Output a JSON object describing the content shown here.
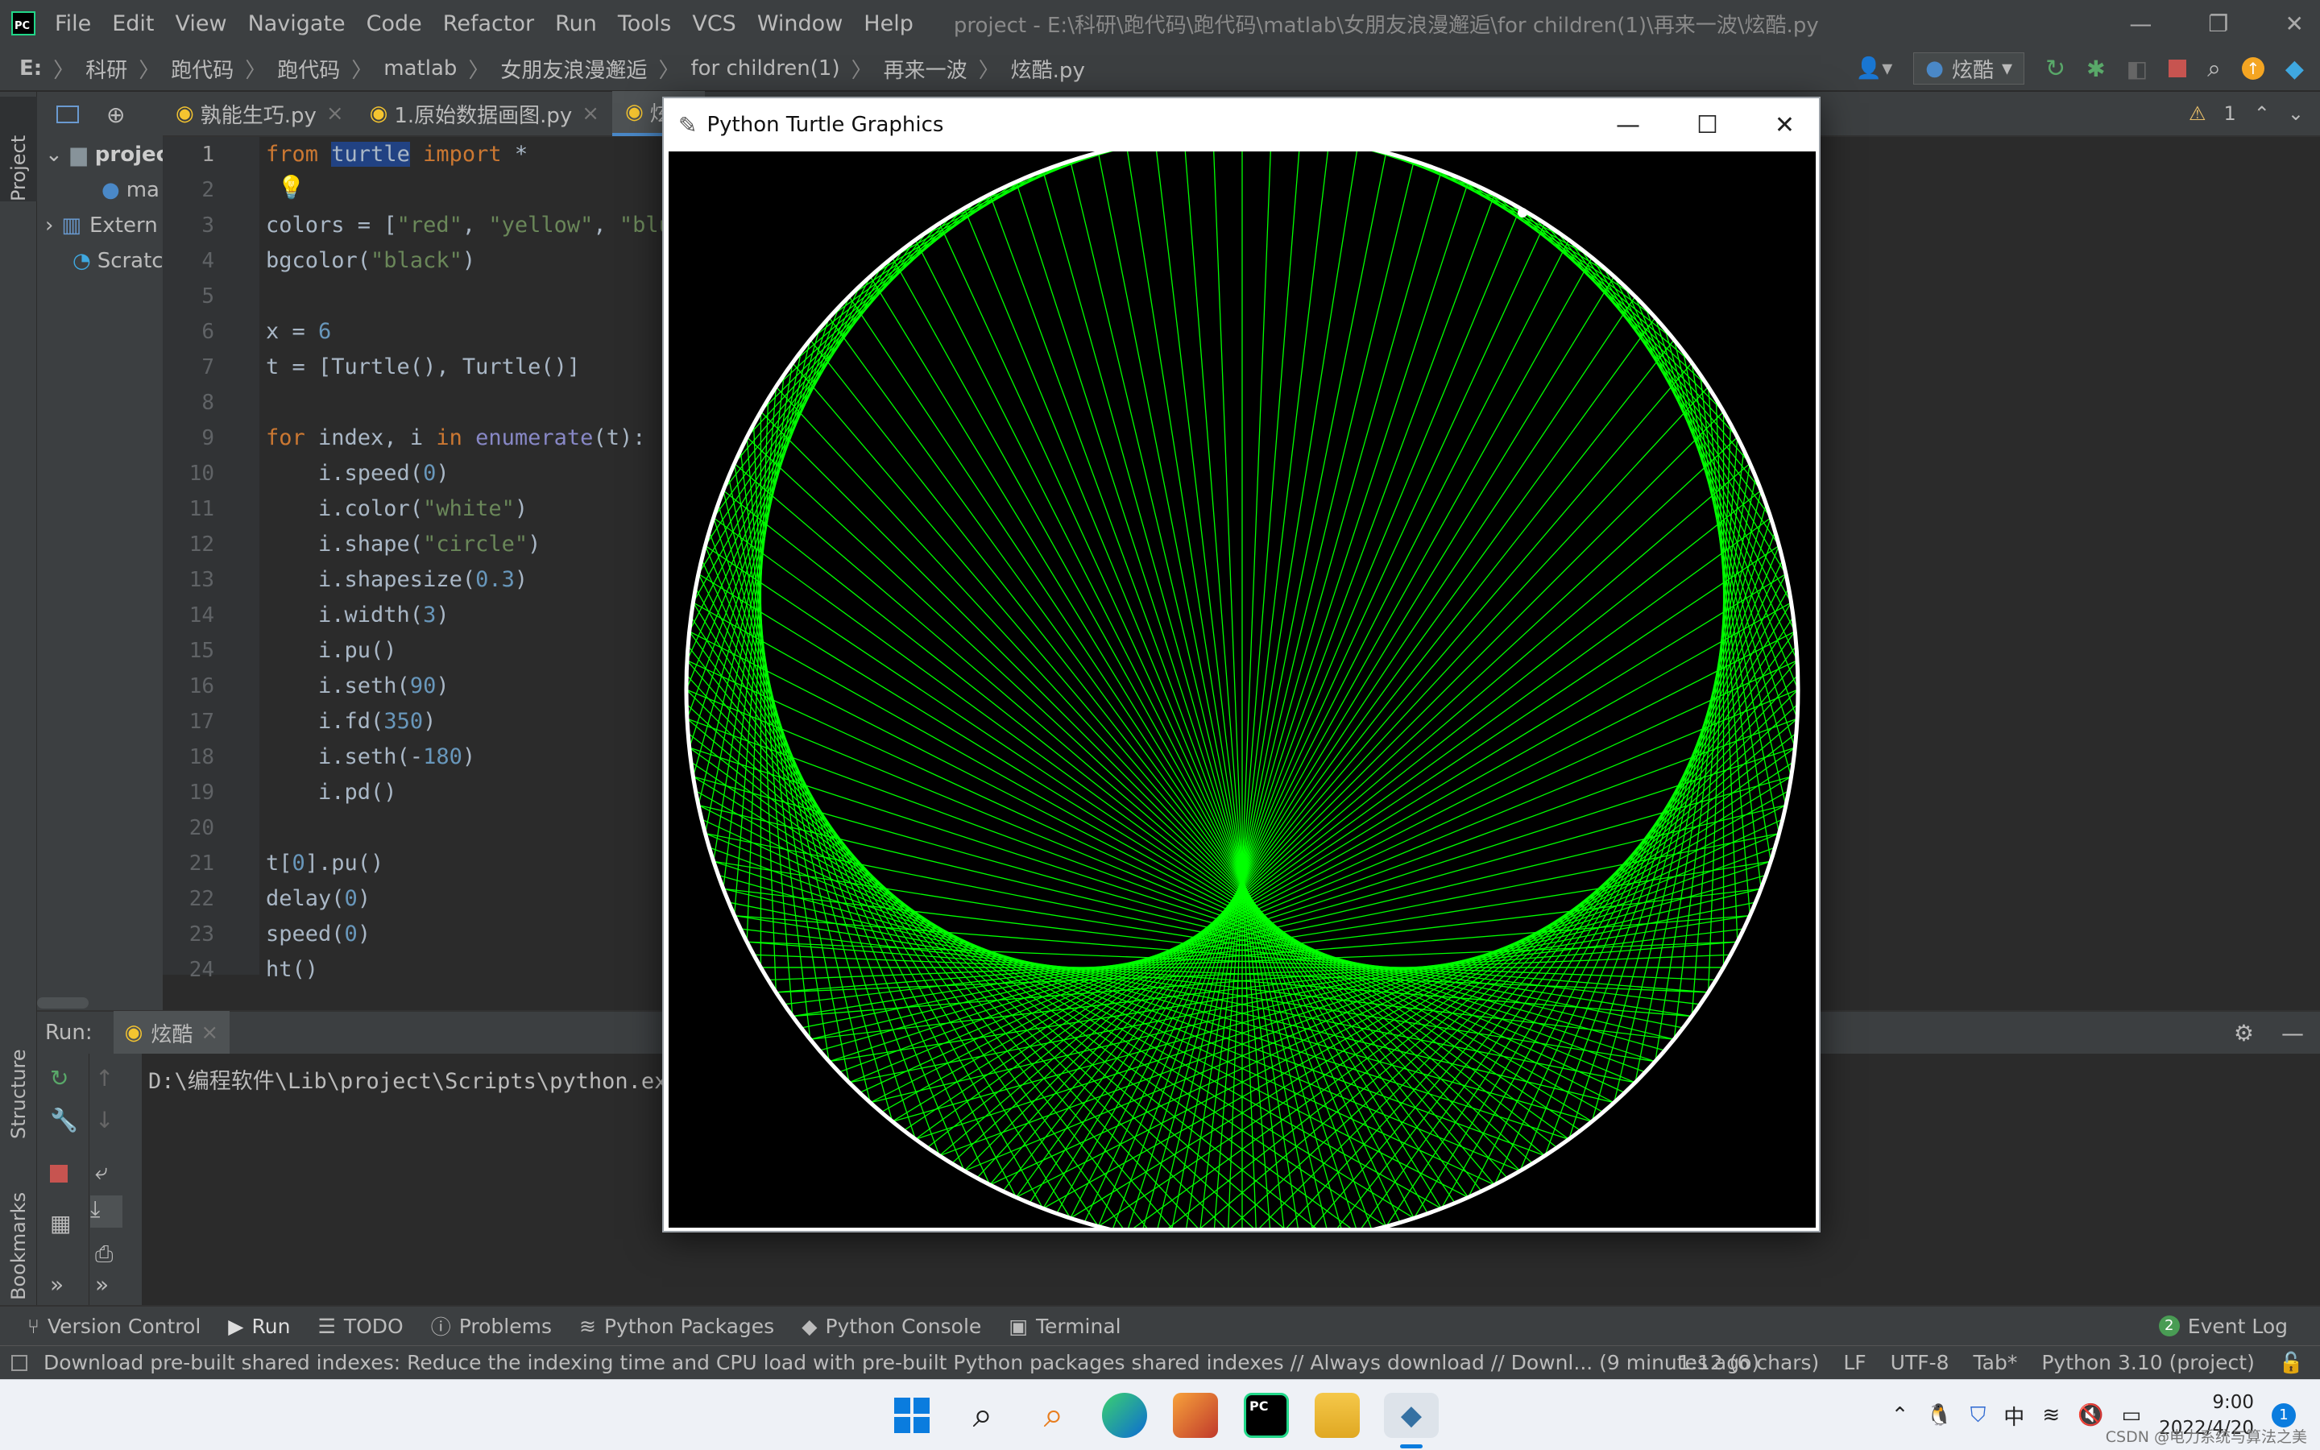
{
  "menubar": {
    "items": [
      "File",
      "Edit",
      "View",
      "Navigate",
      "Code",
      "Refactor",
      "Run",
      "Tools",
      "VCS",
      "Window",
      "Help"
    ],
    "title": "project - E:\\科研\\跑代码\\跑代码\\matlab\\女朋友浪漫邂逅\\for children(1)\\再来一波\\炫酷.py"
  },
  "breadcrumb": {
    "items": [
      "E:",
      "科研",
      "跑代码",
      "跑代码",
      "matlab",
      "女朋友浪漫邂逅",
      "for children(1)",
      "再来一波",
      "炫酷.py"
    ],
    "run_config": "炫酷"
  },
  "project_panel": {
    "label": "Project",
    "items": [
      "projec",
      "ma",
      "Extern",
      "Scratc"
    ]
  },
  "editor_tabs": [
    {
      "label": "孰能生巧.py"
    },
    {
      "label": "1.原始数据画图.py"
    },
    {
      "label": "炫酷"
    }
  ],
  "inspections": "1",
  "code_lines": [
    {
      "n": "1",
      "html": "<span class='kw'>from</span> <span class='hl'>turtle</span> <span class='kw'>import</span> *"
    },
    {
      "n": "2",
      "html": ""
    },
    {
      "n": "3",
      "html": "colors = [<span class='st'>\"red\"</span>, <span class='st'>\"yellow\"</span>, <span class='st'>\"blu</span>"
    },
    {
      "n": "4",
      "html": "bgcolor(<span class='st'>\"black\"</span>)"
    },
    {
      "n": "5",
      "html": ""
    },
    {
      "n": "6",
      "html": "x = <span class='nm'>6</span>"
    },
    {
      "n": "7",
      "html": "t = [Turtle(), Turtle()]"
    },
    {
      "n": "8",
      "html": ""
    },
    {
      "n": "9",
      "html": "<span class='kw'>for</span> index, i <span class='kw'>in</span> <span class='fn'>enumerate</span>(t):"
    },
    {
      "n": "10",
      "html": "    i.speed(<span class='nm'>0</span>)"
    },
    {
      "n": "11",
      "html": "    i.color(<span class='st'>\"white\"</span>)"
    },
    {
      "n": "12",
      "html": "    i.shape(<span class='st'>\"circle\"</span>)"
    },
    {
      "n": "13",
      "html": "    i.shapesize(<span class='nm'>0.3</span>)"
    },
    {
      "n": "14",
      "html": "    i.width(<span class='nm'>3</span>)"
    },
    {
      "n": "15",
      "html": "    i.pu()"
    },
    {
      "n": "16",
      "html": "    i.seth(<span class='nm'>90</span>)"
    },
    {
      "n": "17",
      "html": "    i.fd(<span class='nm'>350</span>)"
    },
    {
      "n": "18",
      "html": "    i.seth(-<span class='nm'>180</span>)"
    },
    {
      "n": "19",
      "html": "    i.pd()"
    },
    {
      "n": "20",
      "html": ""
    },
    {
      "n": "21",
      "html": "t[<span class='nm'>0</span>].pu()"
    },
    {
      "n": "22",
      "html": "delay(<span class='nm'>0</span>)"
    },
    {
      "n": "23",
      "html": "speed(<span class='nm'>0</span>)"
    },
    {
      "n": "24",
      "html": "ht()"
    }
  ],
  "run_panel": {
    "label": "Run:",
    "tab": "炫酷",
    "console_line": "D:\\编程软件\\Lib\\project\\Scripts\\python.exe"
  },
  "side_labels": {
    "structure": "Structure",
    "bookmarks": "Bookmarks"
  },
  "bottom_tabs": [
    "Version Control",
    "Run",
    "TODO",
    "Problems",
    "Python Packages",
    "Python Console",
    "Terminal"
  ],
  "event_log": {
    "count": "2",
    "label": "Event Log"
  },
  "status": {
    "message": "Download pre-built shared indexes: Reduce the indexing time and CPU load with pre-built Python packages shared indexes // Always download // Downl... (9 minutes ago)",
    "position": "1:12 (6 chars)",
    "line_sep": "LF",
    "encoding": "UTF-8",
    "indent": "Tab*",
    "interpreter": "Python 3.10 (project)"
  },
  "turtle_window": {
    "title": "Python Turtle Graphics",
    "bg": "#000000",
    "line_color": "#00ff00",
    "circle_color": "#ffffff"
  },
  "taskbar": {
    "ime": "中",
    "time": "9:00",
    "date": "2022/4/20",
    "notif": "1",
    "watermark": "CSDN @电力系统与算法之美"
  },
  "colors": {
    "accent": "#4a88c7",
    "ide_bg": "#2b2b2b",
    "panel": "#3c3f41"
  }
}
